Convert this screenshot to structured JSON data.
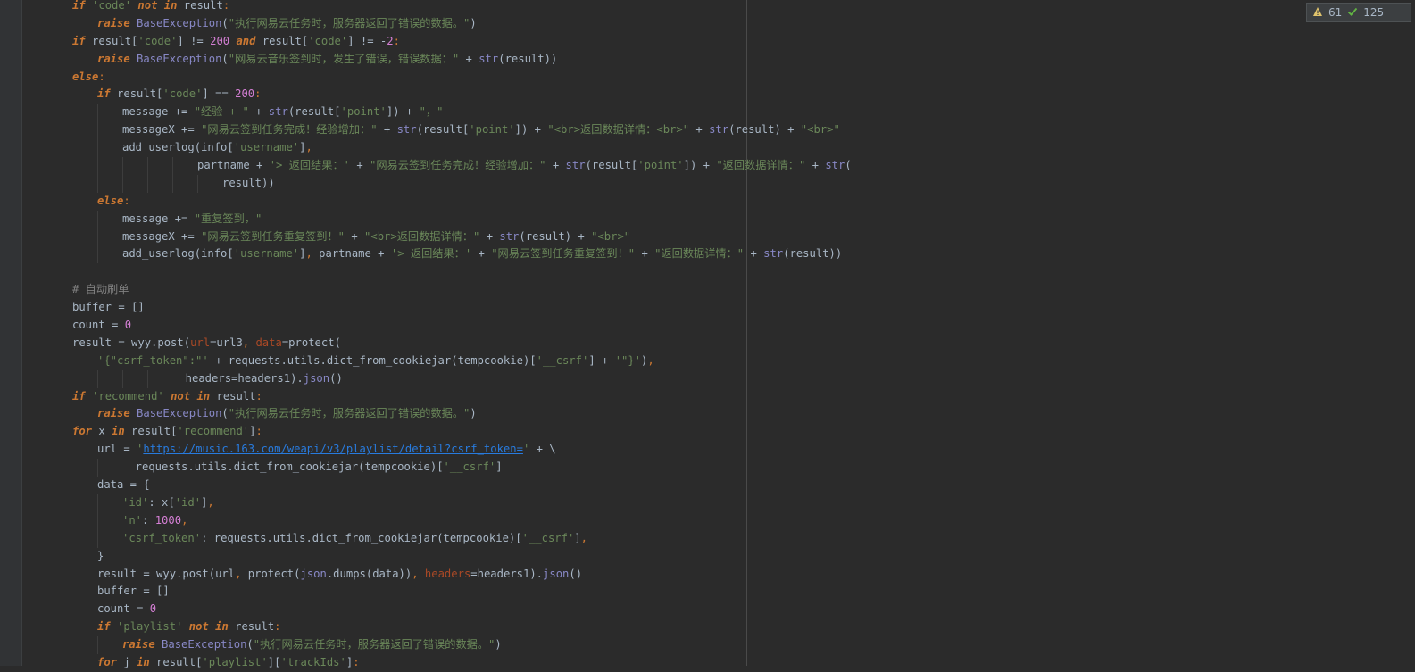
{
  "inspection": {
    "warnings": "61",
    "weak_warnings": "125",
    "warning_icon": "warning-triangle-icon",
    "weak_warning_icon": "check-icon"
  },
  "colors": {
    "background": "#2b2b2b",
    "keyword": "#cc7832",
    "string": "#6a8759",
    "builtin": "#8888c6",
    "number": "#6897bb",
    "comment": "#808080"
  },
  "code_lines": [
    "if 'code' not in result:",
    "    raise BaseException(\"执行网易云任务时，服务器返回了错误的数据。\")",
    "if result['code'] != 200 and result['code'] != -2:",
    "    raise BaseException(\"网易云音乐签到时，发生了错误，错误数据：\" + str(result))",
    "else:",
    "    if result['code'] == 200:",
    "        message += \"经验 + \" + str(result['point']) + \"，\"",
    "        messageX += \"网易云签到任务完成！经验增加：\" + str(result['point']) + \"<br>返回数据详情：<br>\" + str(result) + \"<br>\"",
    "        add_userlog(info['username'],",
    "                    partname + '> 返回结果：' + \"网易云签到任务完成！经验增加：\" + str(result['point']) + \"返回数据详情：\" + str(",
    "                        result))",
    "    else:",
    "        message += \"重复签到，\"",
    "        messageX += \"网易云签到任务重复签到！\" + \"<br>返回数据详情：\" + str(result) + \"<br>\"",
    "        add_userlog(info['username'], partname + '> 返回结果：' + \"网易云签到任务重复签到！\" + \"返回数据详情：\" + str(result))",
    "",
    "# 自动刷单",
    "buffer = []",
    "count = 0",
    "result = wyy.post(url=url3, data=protect(",
    "    '{\"csrf_token\":\"' + requests.utils.dict_from_cookiejar(tempcookie)['__csrf'] + '\"}'),",
    "                  headers=headers1).json()",
    "if 'recommend' not in result:",
    "    raise BaseException(\"执行网易云任务时，服务器返回了错误的数据。\")",
    "for x in result['recommend']:",
    "    url = 'https://music.163.com/weapi/v3/playlist/detail?csrf_token=' + \\",
    "          requests.utils.dict_from_cookiejar(tempcookie)['__csrf']",
    "    data = {",
    "        'id': x['id'],",
    "        'n': 1000,",
    "        'csrf_token': requests.utils.dict_from_cookiejar(tempcookie)['__csrf'],",
    "    }",
    "    result = wyy.post(url, protect(json.dumps(data)), headers=headers1).json()",
    "    buffer = []",
    "    count = 0",
    "    if 'playlist' not in result:",
    "        raise BaseException(\"执行网易云任务时，服务器返回了错误的数据。\")",
    "    for j in result['playlist']['trackIds']:"
  ]
}
